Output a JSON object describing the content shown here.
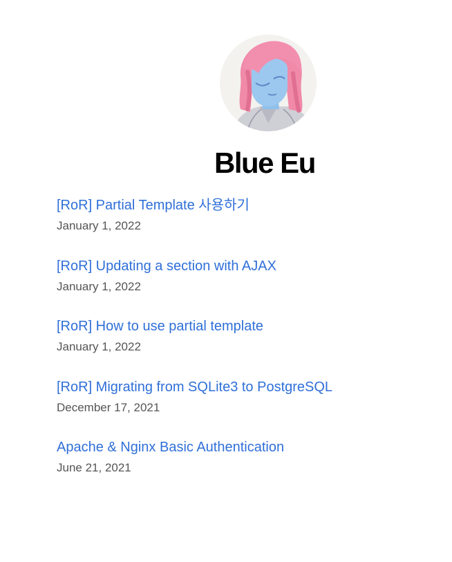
{
  "site": {
    "title": "Blue Eu"
  },
  "posts": [
    {
      "title": "[RoR] Partial Template 사용하기",
      "date": "January 1, 2022"
    },
    {
      "title": "[RoR] Updating a section with AJAX",
      "date": "January 1, 2022"
    },
    {
      "title": "[RoR] How to use partial template",
      "date": "January 1, 2022"
    },
    {
      "title": "[RoR] Migrating from SQLite3 to PostgreSQL",
      "date": "December 17, 2021"
    },
    {
      "title": "Apache & Nginx Basic Authentication",
      "date": "June 21, 2021"
    }
  ],
  "colors": {
    "link": "#2f6fd8",
    "date": "#555555",
    "title": "#000000"
  },
  "icons": {
    "avatar": "avatar-illustration-icon"
  }
}
